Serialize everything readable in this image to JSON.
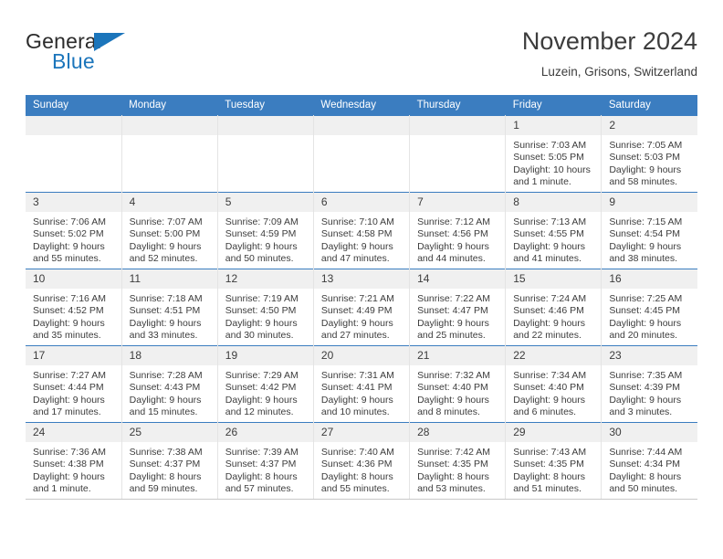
{
  "brand": {
    "name_part1": "General",
    "name_part2": "Blue",
    "logo_icon": "triangle-logo-icon",
    "accent_color": "#1b75bb"
  },
  "header": {
    "title": "November 2024",
    "subtitle": "Luzein, Grisons, Switzerland"
  },
  "calendar": {
    "header_color": "#3b7dc0",
    "daynum_bg": "#f0f0f0",
    "weekdays": [
      "Sunday",
      "Monday",
      "Tuesday",
      "Wednesday",
      "Thursday",
      "Friday",
      "Saturday"
    ],
    "weeks": [
      [
        {
          "day": "",
          "sunrise": "",
          "sunset": "",
          "daylight1": "",
          "daylight2": ""
        },
        {
          "day": "",
          "sunrise": "",
          "sunset": "",
          "daylight1": "",
          "daylight2": ""
        },
        {
          "day": "",
          "sunrise": "",
          "sunset": "",
          "daylight1": "",
          "daylight2": ""
        },
        {
          "day": "",
          "sunrise": "",
          "sunset": "",
          "daylight1": "",
          "daylight2": ""
        },
        {
          "day": "",
          "sunrise": "",
          "sunset": "",
          "daylight1": "",
          "daylight2": ""
        },
        {
          "day": "1",
          "sunrise": "Sunrise: 7:03 AM",
          "sunset": "Sunset: 5:05 PM",
          "daylight1": "Daylight: 10 hours",
          "daylight2": "and 1 minute."
        },
        {
          "day": "2",
          "sunrise": "Sunrise: 7:05 AM",
          "sunset": "Sunset: 5:03 PM",
          "daylight1": "Daylight: 9 hours",
          "daylight2": "and 58 minutes."
        }
      ],
      [
        {
          "day": "3",
          "sunrise": "Sunrise: 7:06 AM",
          "sunset": "Sunset: 5:02 PM",
          "daylight1": "Daylight: 9 hours",
          "daylight2": "and 55 minutes."
        },
        {
          "day": "4",
          "sunrise": "Sunrise: 7:07 AM",
          "sunset": "Sunset: 5:00 PM",
          "daylight1": "Daylight: 9 hours",
          "daylight2": "and 52 minutes."
        },
        {
          "day": "5",
          "sunrise": "Sunrise: 7:09 AM",
          "sunset": "Sunset: 4:59 PM",
          "daylight1": "Daylight: 9 hours",
          "daylight2": "and 50 minutes."
        },
        {
          "day": "6",
          "sunrise": "Sunrise: 7:10 AM",
          "sunset": "Sunset: 4:58 PM",
          "daylight1": "Daylight: 9 hours",
          "daylight2": "and 47 minutes."
        },
        {
          "day": "7",
          "sunrise": "Sunrise: 7:12 AM",
          "sunset": "Sunset: 4:56 PM",
          "daylight1": "Daylight: 9 hours",
          "daylight2": "and 44 minutes."
        },
        {
          "day": "8",
          "sunrise": "Sunrise: 7:13 AM",
          "sunset": "Sunset: 4:55 PM",
          "daylight1": "Daylight: 9 hours",
          "daylight2": "and 41 minutes."
        },
        {
          "day": "9",
          "sunrise": "Sunrise: 7:15 AM",
          "sunset": "Sunset: 4:54 PM",
          "daylight1": "Daylight: 9 hours",
          "daylight2": "and 38 minutes."
        }
      ],
      [
        {
          "day": "10",
          "sunrise": "Sunrise: 7:16 AM",
          "sunset": "Sunset: 4:52 PM",
          "daylight1": "Daylight: 9 hours",
          "daylight2": "and 35 minutes."
        },
        {
          "day": "11",
          "sunrise": "Sunrise: 7:18 AM",
          "sunset": "Sunset: 4:51 PM",
          "daylight1": "Daylight: 9 hours",
          "daylight2": "and 33 minutes."
        },
        {
          "day": "12",
          "sunrise": "Sunrise: 7:19 AM",
          "sunset": "Sunset: 4:50 PM",
          "daylight1": "Daylight: 9 hours",
          "daylight2": "and 30 minutes."
        },
        {
          "day": "13",
          "sunrise": "Sunrise: 7:21 AM",
          "sunset": "Sunset: 4:49 PM",
          "daylight1": "Daylight: 9 hours",
          "daylight2": "and 27 minutes."
        },
        {
          "day": "14",
          "sunrise": "Sunrise: 7:22 AM",
          "sunset": "Sunset: 4:47 PM",
          "daylight1": "Daylight: 9 hours",
          "daylight2": "and 25 minutes."
        },
        {
          "day": "15",
          "sunrise": "Sunrise: 7:24 AM",
          "sunset": "Sunset: 4:46 PM",
          "daylight1": "Daylight: 9 hours",
          "daylight2": "and 22 minutes."
        },
        {
          "day": "16",
          "sunrise": "Sunrise: 7:25 AM",
          "sunset": "Sunset: 4:45 PM",
          "daylight1": "Daylight: 9 hours",
          "daylight2": "and 20 minutes."
        }
      ],
      [
        {
          "day": "17",
          "sunrise": "Sunrise: 7:27 AM",
          "sunset": "Sunset: 4:44 PM",
          "daylight1": "Daylight: 9 hours",
          "daylight2": "and 17 minutes."
        },
        {
          "day": "18",
          "sunrise": "Sunrise: 7:28 AM",
          "sunset": "Sunset: 4:43 PM",
          "daylight1": "Daylight: 9 hours",
          "daylight2": "and 15 minutes."
        },
        {
          "day": "19",
          "sunrise": "Sunrise: 7:29 AM",
          "sunset": "Sunset: 4:42 PM",
          "daylight1": "Daylight: 9 hours",
          "daylight2": "and 12 minutes."
        },
        {
          "day": "20",
          "sunrise": "Sunrise: 7:31 AM",
          "sunset": "Sunset: 4:41 PM",
          "daylight1": "Daylight: 9 hours",
          "daylight2": "and 10 minutes."
        },
        {
          "day": "21",
          "sunrise": "Sunrise: 7:32 AM",
          "sunset": "Sunset: 4:40 PM",
          "daylight1": "Daylight: 9 hours",
          "daylight2": "and 8 minutes."
        },
        {
          "day": "22",
          "sunrise": "Sunrise: 7:34 AM",
          "sunset": "Sunset: 4:40 PM",
          "daylight1": "Daylight: 9 hours",
          "daylight2": "and 6 minutes."
        },
        {
          "day": "23",
          "sunrise": "Sunrise: 7:35 AM",
          "sunset": "Sunset: 4:39 PM",
          "daylight1": "Daylight: 9 hours",
          "daylight2": "and 3 minutes."
        }
      ],
      [
        {
          "day": "24",
          "sunrise": "Sunrise: 7:36 AM",
          "sunset": "Sunset: 4:38 PM",
          "daylight1": "Daylight: 9 hours",
          "daylight2": "and 1 minute."
        },
        {
          "day": "25",
          "sunrise": "Sunrise: 7:38 AM",
          "sunset": "Sunset: 4:37 PM",
          "daylight1": "Daylight: 8 hours",
          "daylight2": "and 59 minutes."
        },
        {
          "day": "26",
          "sunrise": "Sunrise: 7:39 AM",
          "sunset": "Sunset: 4:37 PM",
          "daylight1": "Daylight: 8 hours",
          "daylight2": "and 57 minutes."
        },
        {
          "day": "27",
          "sunrise": "Sunrise: 7:40 AM",
          "sunset": "Sunset: 4:36 PM",
          "daylight1": "Daylight: 8 hours",
          "daylight2": "and 55 minutes."
        },
        {
          "day": "28",
          "sunrise": "Sunrise: 7:42 AM",
          "sunset": "Sunset: 4:35 PM",
          "daylight1": "Daylight: 8 hours",
          "daylight2": "and 53 minutes."
        },
        {
          "day": "29",
          "sunrise": "Sunrise: 7:43 AM",
          "sunset": "Sunset: 4:35 PM",
          "daylight1": "Daylight: 8 hours",
          "daylight2": "and 51 minutes."
        },
        {
          "day": "30",
          "sunrise": "Sunrise: 7:44 AM",
          "sunset": "Sunset: 4:34 PM",
          "daylight1": "Daylight: 8 hours",
          "daylight2": "and 50 minutes."
        }
      ]
    ]
  }
}
